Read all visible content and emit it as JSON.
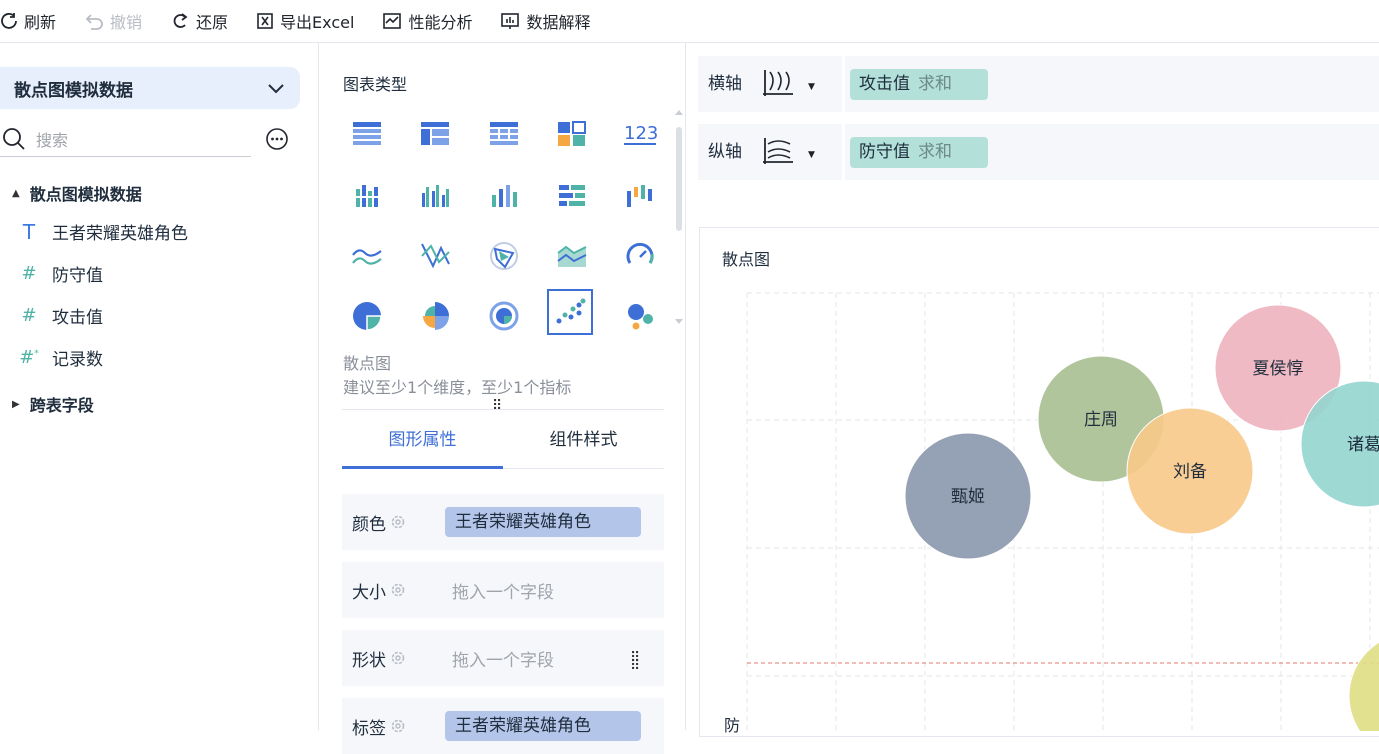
{
  "toolbar": {
    "refresh": "刷新",
    "undo": "撤销",
    "restore": "还原",
    "export": "导出Excel",
    "perf": "性能分析",
    "explain": "数据解释"
  },
  "left": {
    "dataset": "散点图模拟数据",
    "search_placeholder": "搜索",
    "group1": "散点图模拟数据",
    "fields": [
      {
        "icon": "T",
        "label": "王者荣耀英雄角色"
      },
      {
        "icon": "#",
        "label": "防守值"
      },
      {
        "icon": "#",
        "label": "攻击值"
      },
      {
        "icon": "#*",
        "label": "记录数"
      }
    ],
    "group2": "跨表字段"
  },
  "middle": {
    "title": "图表类型",
    "type_name": "散点图",
    "type_hint": "建议至少1个维度，至少1个指标",
    "tabs": [
      "图形属性",
      "组件样式"
    ],
    "props": [
      {
        "label": "颜色",
        "value": "王者荣耀英雄角色"
      },
      {
        "label": "大小",
        "placeholder": "拖入一个字段"
      },
      {
        "label": "形状",
        "placeholder": "拖入一个字段"
      },
      {
        "label": "标签",
        "value": "王者荣耀英雄角色"
      }
    ]
  },
  "axes": {
    "x_label": "横轴",
    "x_field": "攻击值",
    "x_agg": "求和",
    "y_label": "纵轴",
    "y_field": "防守值",
    "y_agg": "求和"
  },
  "chart_data": {
    "type": "scatter",
    "title": "散点图",
    "ylabel": "防",
    "points": [
      {
        "name": "甄姬",
        "color": "#8a97ac"
      },
      {
        "name": "庄周",
        "color": "#a9bf91"
      },
      {
        "name": "刘备",
        "color": "#f8c98a"
      },
      {
        "name": "夏侯惇",
        "color": "#edb3be"
      },
      {
        "name": "诸葛亮",
        "label": "诸葛",
        "color": "#93d5cf"
      },
      {
        "name": "",
        "color": "#dede84"
      }
    ],
    "colors": {
      "reference_line": "#e07a6a"
    }
  }
}
